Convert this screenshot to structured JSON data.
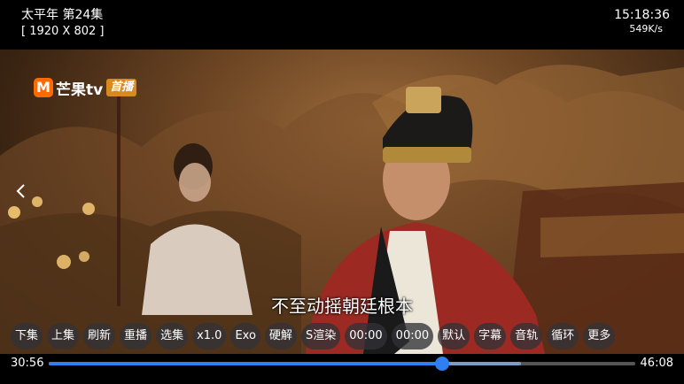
{
  "header": {
    "title": "太平年 第24集",
    "resolution": "[ 1920 X 802 ]",
    "clock": "15:18:36",
    "speed": "549K/s"
  },
  "video": {
    "logo_text": "芒果tv",
    "logo_badge": "首播",
    "subtitle": "不至动摇朝廷根本"
  },
  "controls": {
    "buttons": [
      "下集",
      "上集",
      "刷新",
      "重播",
      "选集",
      "x1.0",
      "Exo",
      "硬解",
      "S渲染",
      "00:00",
      "00:00",
      "默认",
      "字幕",
      "音轨",
      "循环",
      "更多"
    ]
  },
  "progress": {
    "current": "30:56",
    "total": "46:08",
    "played_fraction": 0.6705,
    "buffered_fraction": 0.805
  },
  "colors": {
    "accent": "#2f7ff0",
    "logo_orange": "#ff6a00"
  }
}
